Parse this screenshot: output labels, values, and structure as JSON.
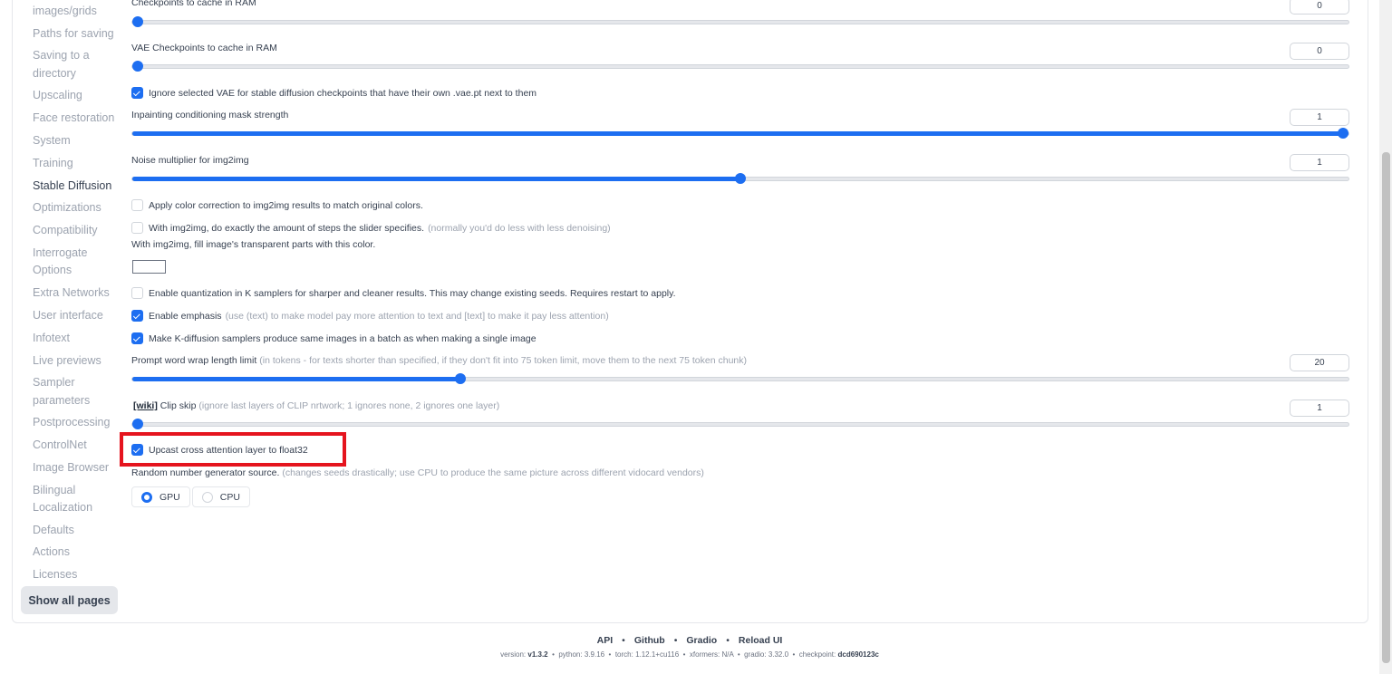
{
  "sidebar": {
    "items": [
      {
        "label": "images/grids",
        "active": false
      },
      {
        "label": "Paths for saving",
        "active": false
      },
      {
        "label": "Saving to a",
        "active": false
      },
      {
        "label": "directory",
        "active": false
      },
      {
        "label": "Upscaling",
        "active": false
      },
      {
        "label": "Face restoration",
        "active": false
      },
      {
        "label": "System",
        "active": false
      },
      {
        "label": "Training",
        "active": false
      },
      {
        "label": "Stable Diffusion",
        "active": true
      },
      {
        "label": "Optimizations",
        "active": false
      },
      {
        "label": "Compatibility",
        "active": false
      },
      {
        "label": "Interrogate",
        "active": false
      },
      {
        "label": "Options",
        "active": false
      },
      {
        "label": "Extra Networks",
        "active": false
      },
      {
        "label": "User interface",
        "active": false
      },
      {
        "label": "Infotext",
        "active": false
      },
      {
        "label": "Live previews",
        "active": false
      },
      {
        "label": "Sampler",
        "active": false
      },
      {
        "label": "parameters",
        "active": false
      },
      {
        "label": "Postprocessing",
        "active": false
      },
      {
        "label": "ControlNet",
        "active": false
      },
      {
        "label": "Image Browser",
        "active": false
      },
      {
        "label": "Bilingual",
        "active": false
      },
      {
        "label": "Localization",
        "active": false
      },
      {
        "label": "Defaults",
        "active": false
      },
      {
        "label": "Actions",
        "active": false
      },
      {
        "label": "Licenses",
        "active": false
      }
    ],
    "show_all_label": "Show all pages"
  },
  "settings": {
    "checkpoints_cache": {
      "label": "Checkpoints to cache in RAM",
      "value": "0",
      "fraction": 0.0
    },
    "vae_cache": {
      "label": "VAE Checkpoints to cache in RAM",
      "value": "0",
      "fraction": 0.0
    },
    "ignore_vae": {
      "label": "Ignore selected VAE for stable diffusion checkpoints that have their own .vae.pt next to them",
      "checked": true
    },
    "inpaint_mask": {
      "label": "Inpainting conditioning mask strength",
      "value": "1",
      "fraction": 1.0
    },
    "noise_mult": {
      "label": "Noise multiplier for img2img",
      "value": "1",
      "fraction": 0.5
    },
    "color_correction": {
      "label": "Apply color correction to img2img results to match original colors.",
      "checked": false
    },
    "exact_steps": {
      "label": "With img2img, do exactly the amount of steps the slider specifies.",
      "hint": "(normally you'd do less with less denoising)",
      "checked": false
    },
    "fill_color": {
      "label": "With img2img, fill image's transparent parts with this color."
    },
    "quantization": {
      "label": "Enable quantization in K samplers for sharper and cleaner results. This may change existing seeds. Requires restart to apply.",
      "checked": false
    },
    "emphasis": {
      "label": "Enable emphasis",
      "hint": "(use (text) to make model pay more attention to text and [text] to make it pay less attention)",
      "checked": true
    },
    "batch_same": {
      "label": "Make K-diffusion samplers produce same images in a batch as when making a single image",
      "checked": true
    },
    "wrap_limit": {
      "label": "Prompt word wrap length limit",
      "hint": "(in tokens - for texts shorter than specified, if they don't fit into 75 token limit, move them to the next 75 token chunk)",
      "value": "20",
      "fraction": 0.27
    },
    "clip_skip": {
      "wiki": "[wiki]",
      "label": " Clip skip",
      "hint": "(ignore last layers of CLIP nrtwork; 1 ignores none, 2 ignores one layer)",
      "value": "1",
      "fraction": 0.0
    },
    "upcast": {
      "label": "Upcast cross attention layer to float32",
      "checked": true
    },
    "rng": {
      "label": "Random number generator source.",
      "hint": "(changes seeds drastically; use CPU to produce the same picture across different vidocard vendors)",
      "options": [
        "GPU",
        "CPU"
      ],
      "selected": "GPU"
    }
  },
  "footer": {
    "links": [
      "API",
      "Github",
      "Gradio",
      "Reload UI"
    ],
    "separator": "•",
    "version": {
      "version_label": "version:",
      "version_value": "v1.3.2",
      "python_label": "python:",
      "python_value": "3.9.16",
      "torch_label": "torch:",
      "torch_value": "1.12.1+cu116",
      "xformers_label": "xformers:",
      "xformers_value": "N/A",
      "gradio_label": "gradio:",
      "gradio_value": "3.32.0",
      "checkpoint_label": "checkpoint:",
      "checkpoint_value": "dcd690123c"
    }
  },
  "colors": {
    "accent": "#1d6ef1",
    "highlight": "#e5141e"
  }
}
